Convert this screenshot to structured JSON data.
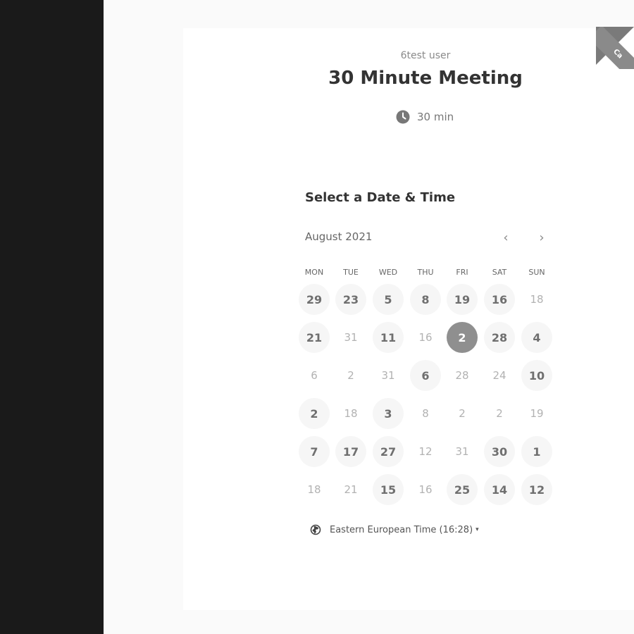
{
  "header": {
    "host_name": "6test user",
    "event_title": "30 Minute Meeting",
    "duration": "30 min",
    "clock_icon": "clock-icon",
    "ribbon_text": "Ca"
  },
  "calendar": {
    "heading": "Select a Date & Time",
    "month": "August 2021",
    "prev_label": "‹",
    "next_label": "›",
    "weekdays": [
      "MON",
      "TUE",
      "WED",
      "THU",
      "FRI",
      "SAT",
      "SUN"
    ],
    "weeks": [
      [
        {
          "label": "29",
          "state": "available"
        },
        {
          "label": "23",
          "state": "available"
        },
        {
          "label": "5",
          "state": "available"
        },
        {
          "label": "8",
          "state": "available"
        },
        {
          "label": "19",
          "state": "available"
        },
        {
          "label": "16",
          "state": "available"
        },
        {
          "label": "18",
          "state": "unavailable"
        }
      ],
      [
        {
          "label": "21",
          "state": "available"
        },
        {
          "label": "31",
          "state": "unavailable"
        },
        {
          "label": "11",
          "state": "available"
        },
        {
          "label": "16",
          "state": "unavailable"
        },
        {
          "label": "2",
          "state": "selected"
        },
        {
          "label": "28",
          "state": "available"
        },
        {
          "label": "4",
          "state": "available"
        }
      ],
      [
        {
          "label": "6",
          "state": "unavailable"
        },
        {
          "label": "2",
          "state": "unavailable"
        },
        {
          "label": "31",
          "state": "unavailable"
        },
        {
          "label": "6",
          "state": "available"
        },
        {
          "label": "28",
          "state": "unavailable"
        },
        {
          "label": "24",
          "state": "unavailable"
        },
        {
          "label": "10",
          "state": "available"
        }
      ],
      [
        {
          "label": "2",
          "state": "available"
        },
        {
          "label": "18",
          "state": "unavailable"
        },
        {
          "label": "3",
          "state": "available"
        },
        {
          "label": "8",
          "state": "unavailable"
        },
        {
          "label": "2",
          "state": "unavailable"
        },
        {
          "label": "2",
          "state": "unavailable"
        },
        {
          "label": "19",
          "state": "unavailable"
        }
      ],
      [
        {
          "label": "7",
          "state": "available"
        },
        {
          "label": "17",
          "state": "available"
        },
        {
          "label": "27",
          "state": "available"
        },
        {
          "label": "12",
          "state": "unavailable"
        },
        {
          "label": "31",
          "state": "unavailable"
        },
        {
          "label": "30",
          "state": "available"
        },
        {
          "label": "1",
          "state": "available"
        }
      ],
      [
        {
          "label": "18",
          "state": "unavailable"
        },
        {
          "label": "21",
          "state": "unavailable"
        },
        {
          "label": "15",
          "state": "available"
        },
        {
          "label": "16",
          "state": "unavailable"
        },
        {
          "label": "25",
          "state": "available"
        },
        {
          "label": "14",
          "state": "available"
        },
        {
          "label": "12",
          "state": "available"
        }
      ]
    ]
  },
  "timezone": {
    "label": "Eastern European Time (16:28)",
    "caret": "▾",
    "icon": "globe-icon"
  },
  "colors": {
    "left_panel": "#1a1a1a",
    "selected_day": "#8f8f8f",
    "available_day_bg": "#f6f6f6"
  }
}
